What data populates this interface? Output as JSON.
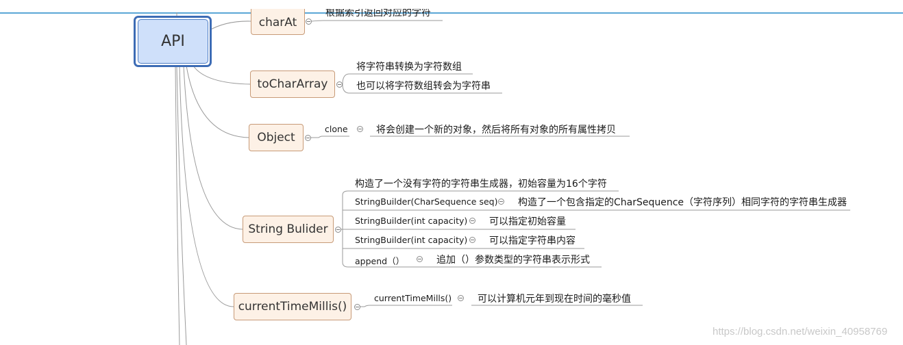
{
  "root": {
    "label": "API"
  },
  "nodes": {
    "charat": {
      "label": "charAt",
      "desc": "根据索引返回对应的字符"
    },
    "tochararray": {
      "label": "toCharArray",
      "items": [
        "将字符串转换为字符数组",
        "也可以将字符数组转会为字符串"
      ]
    },
    "object": {
      "label": "Object",
      "method": "clone",
      "desc": "将会创建一个新的对象，然后将所有对象的所有属性拷贝"
    },
    "stringbuilder": {
      "label": "String Bulider",
      "summary": "构造了一个没有字符的字符串生成器，初始容量为16个字符",
      "items": [
        {
          "method": "StringBuilder(CharSequence seq)",
          "desc": "构造了一个包含指定的CharSequence（字符序列）相同字符的字符串生成器"
        },
        {
          "method": "StringBuilder(int capacity)",
          "desc": "可以指定初始容量"
        },
        {
          "method": "StringBuilder(int capacity)",
          "desc": "可以指定字符串内容"
        },
        {
          "method": "append（）",
          "desc": "追加（）参数类型的字符串表示形式"
        }
      ]
    },
    "currenttimemillis": {
      "label": "currentTimeMillis()",
      "method": "currentTimeMills()",
      "desc": "可以计算机元年到现在时间的毫秒值"
    }
  },
  "watermark": "https://blog.csdn.net/weixin_40958769",
  "colors": {
    "root_fill": "#cfe0fa",
    "root_border": "#3d6cb5",
    "node_fill": "#fdf1e6",
    "node_border": "#c79a77",
    "line": "#999999",
    "top_border": "#5aa6d6"
  }
}
